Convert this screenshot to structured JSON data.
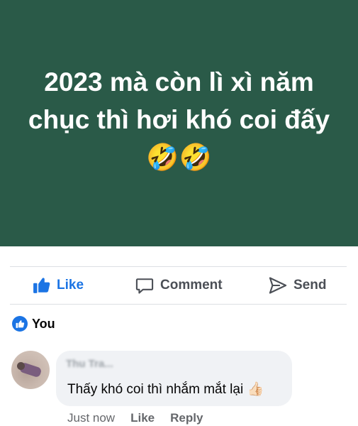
{
  "post": {
    "text": "2023 mà còn lì xì năm chục thì hơi khó coi đấy 🤣🤣",
    "background_color": "#2a5a48"
  },
  "actions": {
    "like": "Like",
    "comment": "Comment",
    "send": "Send"
  },
  "reactions": {
    "reactor": "You",
    "icon": "like-icon"
  },
  "comment": {
    "author": "Thu Tra...",
    "text": "Thấy khó coi thì nhắm mắt lại 👍🏻",
    "time": "Just now",
    "like_label": "Like",
    "reply_label": "Reply"
  },
  "colors": {
    "accent": "#1b74e4",
    "muted": "#65676b",
    "bubble": "#f0f2f5"
  }
}
